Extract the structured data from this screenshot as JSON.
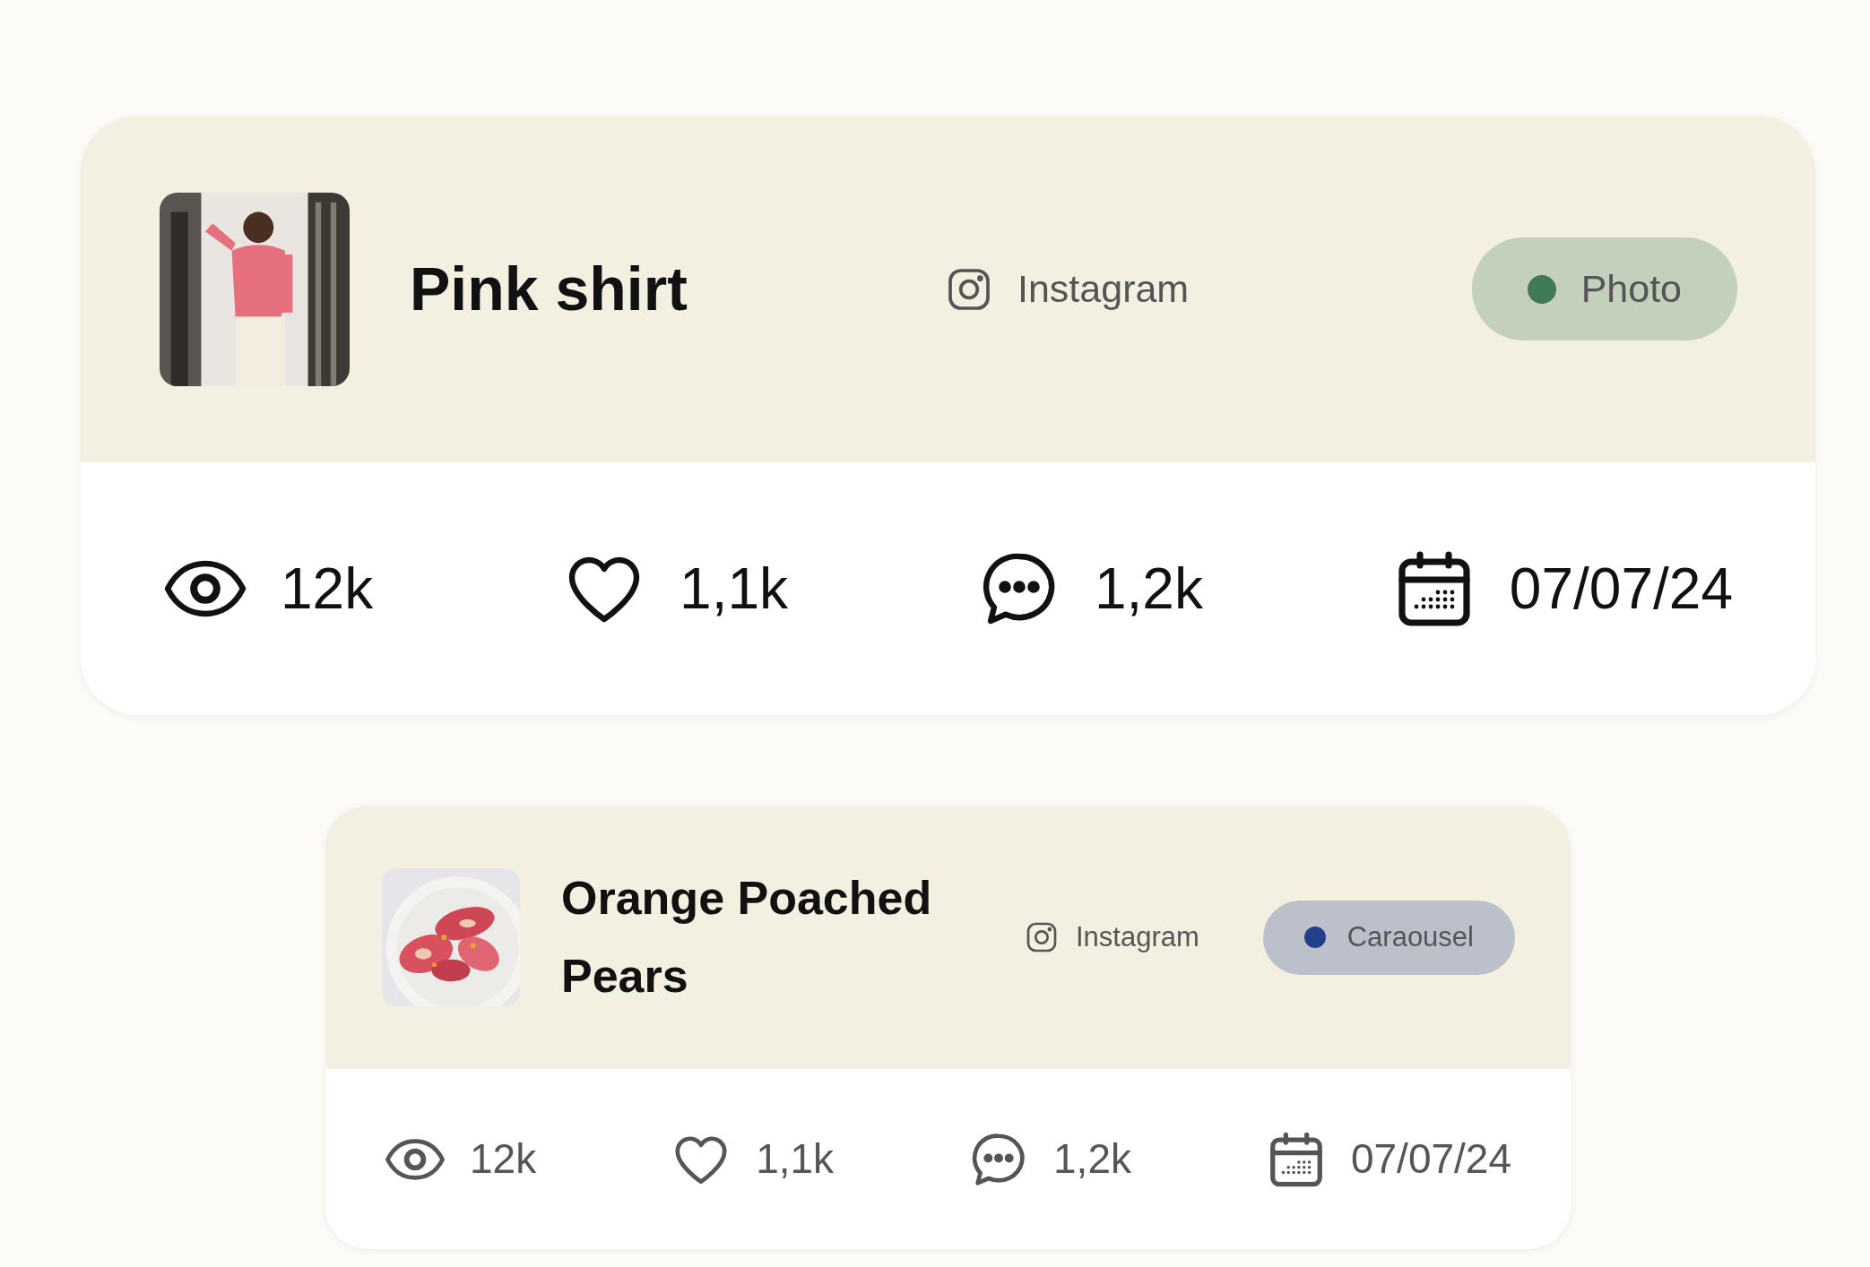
{
  "posts": [
    {
      "kind": "large",
      "title": "Pink shirt",
      "platform": "Instagram",
      "badge": {
        "label": "Photo",
        "color": "#3f7a55"
      },
      "stats": {
        "views": "12k",
        "likes": "1,1k",
        "comments": "1,2k",
        "date": "07/07/24"
      }
    },
    {
      "kind": "small",
      "title": "Orange Poached Pears",
      "platform": "Instagram",
      "badge": {
        "label": "Caraousel",
        "color": "#263f8a"
      },
      "stats": {
        "views": "12k",
        "likes": "1,1k",
        "comments": "1,2k",
        "date": "07/07/24"
      }
    }
  ]
}
